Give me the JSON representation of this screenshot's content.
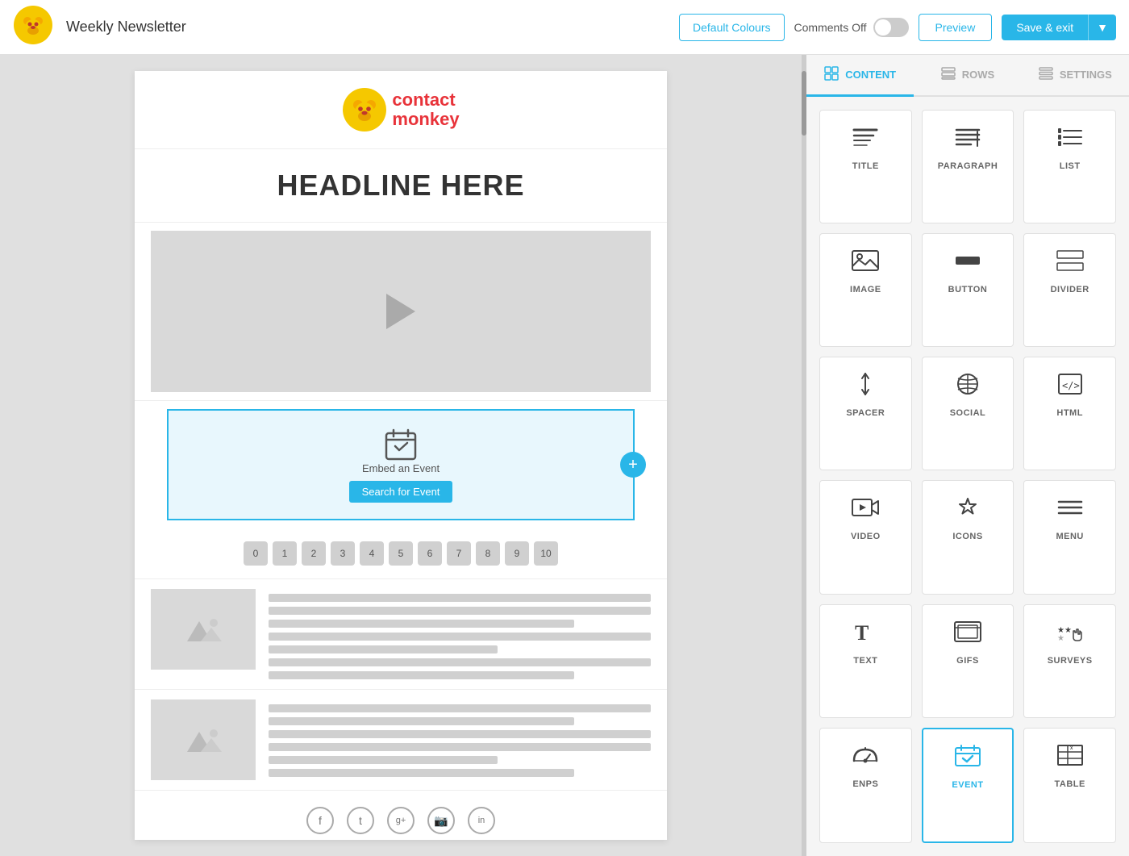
{
  "header": {
    "title": "Weekly Newsletter",
    "btn_default_colours": "Default Colours",
    "comments_label": "Comments Off",
    "btn_preview": "Preview",
    "btn_save": "Save & exit"
  },
  "panel": {
    "tabs": [
      {
        "id": "content",
        "label": "CONTENT",
        "active": true
      },
      {
        "id": "rows",
        "label": "ROWS",
        "active": false
      },
      {
        "id": "settings",
        "label": "SETTINGS",
        "active": false
      }
    ],
    "content_items": [
      {
        "id": "title",
        "label": "TITLE",
        "icon": "title"
      },
      {
        "id": "paragraph",
        "label": "PARAGRAPH",
        "icon": "paragraph"
      },
      {
        "id": "list",
        "label": "LIST",
        "icon": "list"
      },
      {
        "id": "image",
        "label": "IMAGE",
        "icon": "image"
      },
      {
        "id": "button",
        "label": "BUTTON",
        "icon": "button"
      },
      {
        "id": "divider",
        "label": "DIVIDER",
        "icon": "divider"
      },
      {
        "id": "spacer",
        "label": "SPACER",
        "icon": "spacer"
      },
      {
        "id": "social",
        "label": "SOCIAL",
        "icon": "social"
      },
      {
        "id": "html",
        "label": "HTML",
        "icon": "html"
      },
      {
        "id": "video",
        "label": "VIDEO",
        "icon": "video"
      },
      {
        "id": "icons",
        "label": "ICONS",
        "icon": "icons"
      },
      {
        "id": "menu",
        "label": "MENU",
        "icon": "menu"
      },
      {
        "id": "text",
        "label": "TEXT",
        "icon": "text"
      },
      {
        "id": "gifs",
        "label": "GIFS",
        "icon": "gifs"
      },
      {
        "id": "surveys",
        "label": "SURVEYS",
        "icon": "surveys"
      },
      {
        "id": "enps",
        "label": "ENPS",
        "icon": "enps"
      },
      {
        "id": "event",
        "label": "EVENT",
        "icon": "event",
        "selected": true
      },
      {
        "id": "table",
        "label": "TABLE",
        "icon": "table"
      }
    ]
  },
  "canvas": {
    "headline": "HEADLINE HERE",
    "event_label": "Embed an Event",
    "event_search_btn": "Search for Event",
    "pagination": [
      "0",
      "1",
      "2",
      "3",
      "4",
      "5",
      "6",
      "7",
      "8",
      "9",
      "10"
    ],
    "social_icons": [
      "f",
      "t",
      "g+",
      "in",
      "li"
    ]
  }
}
